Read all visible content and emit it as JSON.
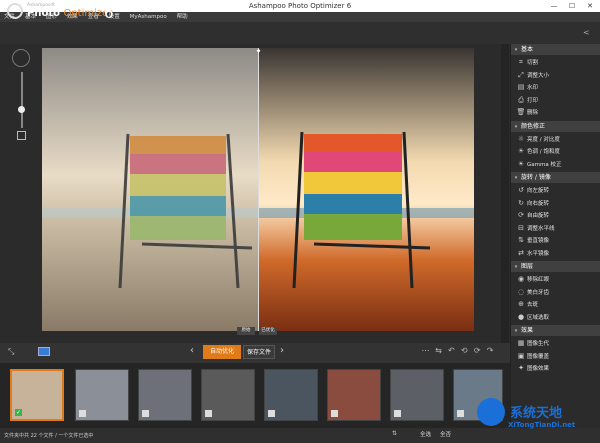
{
  "window": {
    "title": "Ashampoo Photo Optimizer 6",
    "minimize": "—",
    "maximize": "☐",
    "close": "✕"
  },
  "menu": [
    "文件",
    "基本",
    "图形",
    "效果",
    "查看",
    "设置",
    "MyAshampoo",
    "帮助"
  ],
  "logo": {
    "brand": "Ashampoo®",
    "photo": "Photo",
    "optimizer": "Optimizer",
    "version": "6"
  },
  "compare": {
    "before": "原始",
    "after": "已优化"
  },
  "toolbar": {
    "auto_label": "自动优化",
    "save_label": "保存文件"
  },
  "right_panel": {
    "sections": [
      {
        "title": "基本",
        "items": [
          {
            "icon": "crop-icon",
            "label": "切割"
          },
          {
            "icon": "resize-icon",
            "label": "调整大小"
          },
          {
            "icon": "watermark-icon",
            "label": "水印"
          },
          {
            "icon": "print-icon",
            "label": "打印"
          },
          {
            "icon": "delete-icon",
            "label": "删除"
          }
        ]
      },
      {
        "title": "颜色修正",
        "items": [
          {
            "icon": "brightness-icon",
            "label": "亮度 / 对比度"
          },
          {
            "icon": "hue-icon",
            "label": "色调 / 饱和度"
          },
          {
            "icon": "gamma-icon",
            "label": "Gamma 校正"
          }
        ]
      },
      {
        "title": "旋转 / 镜像",
        "items": [
          {
            "icon": "rotate-left-icon",
            "label": "向左旋转"
          },
          {
            "icon": "rotate-right-icon",
            "label": "向右旋转"
          },
          {
            "icon": "free-rotate-icon",
            "label": "自由旋转"
          },
          {
            "icon": "level-icon",
            "label": "调整水平线"
          },
          {
            "icon": "flip-vertical-icon",
            "label": "垂直镜像"
          },
          {
            "icon": "flip-horizontal-icon",
            "label": "水平镜像"
          }
        ]
      },
      {
        "title": "图层",
        "items": [
          {
            "icon": "red-eye-icon",
            "label": "移除红眼"
          },
          {
            "icon": "teeth-icon",
            "label": "美白牙齿"
          },
          {
            "icon": "spot-icon",
            "label": "去斑"
          },
          {
            "icon": "area-icon",
            "label": "区域选取"
          }
        ]
      },
      {
        "title": "效果",
        "items": [
          {
            "icon": "image-effect-icon",
            "label": "图像生代"
          },
          {
            "icon": "overlay-icon",
            "label": "图像覆盖"
          },
          {
            "icon": "effect-icon",
            "label": "图像效果"
          }
        ]
      }
    ]
  },
  "status": {
    "text": "文件夹中共 22 个文件 / 一个文件已选中",
    "select_all": "全选",
    "select_none": "全否"
  },
  "watermark": {
    "name": "系统天地",
    "url": "XiTongTianDi.net"
  }
}
